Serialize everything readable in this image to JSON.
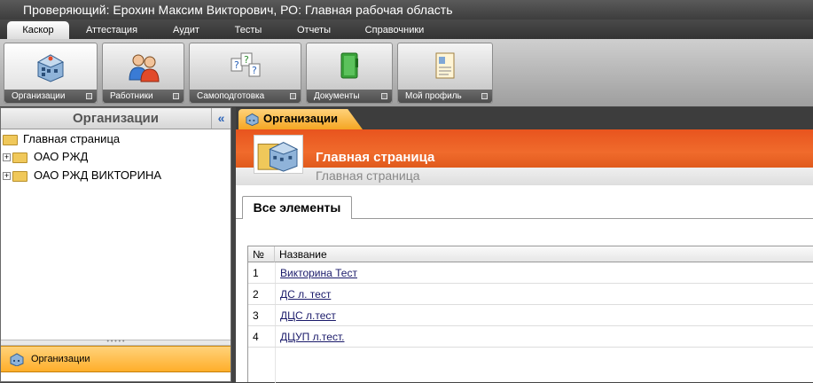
{
  "window": {
    "title": "Проверяющий: Ерохин Максим Викторович, РО: Главная рабочая область"
  },
  "menu": {
    "tabs": [
      "Каскор",
      "Аттестация",
      "Аудит",
      "Тесты",
      "Отчеты",
      "Справочники"
    ],
    "active": "Каскор"
  },
  "ribbon": {
    "buttons": [
      {
        "label": "Организации",
        "icon": "organizations-icon"
      },
      {
        "label": "Работники",
        "icon": "workers-icon"
      },
      {
        "label": "Самоподготовка",
        "icon": "self-study-icon"
      },
      {
        "label": "Документы",
        "icon": "documents-icon"
      },
      {
        "label": "Мой профиль",
        "icon": "profile-icon"
      }
    ]
  },
  "left_panel": {
    "title": "Организации",
    "collapse_glyph": "«",
    "tree": [
      {
        "label": "Главная страница",
        "icon": "home-folder-icon"
      },
      {
        "label": "ОАО РЖД",
        "icon": "folder-icon"
      },
      {
        "label": "ОАО РЖД ВИКТОРИНА",
        "icon": "folder-icon"
      }
    ],
    "section_label": "Организации"
  },
  "right_panel": {
    "tab_label": "Организации",
    "banner_title": "Главная страница",
    "banner_subtitle": "Главная страница",
    "content_tab": "Все элементы",
    "grid": {
      "columns": [
        "№",
        "Название"
      ],
      "rows": [
        {
          "num": "1",
          "name": "Викторина Тест"
        },
        {
          "num": "2",
          "name": "ДС л. тест"
        },
        {
          "num": "3",
          "name": "ДЦС л.тест"
        },
        {
          "num": "4",
          "name": "ДЦУП л.тест."
        }
      ]
    }
  },
  "colors": {
    "accent_orange": "#f06b2c",
    "section_yellow": "#ffae2a"
  }
}
